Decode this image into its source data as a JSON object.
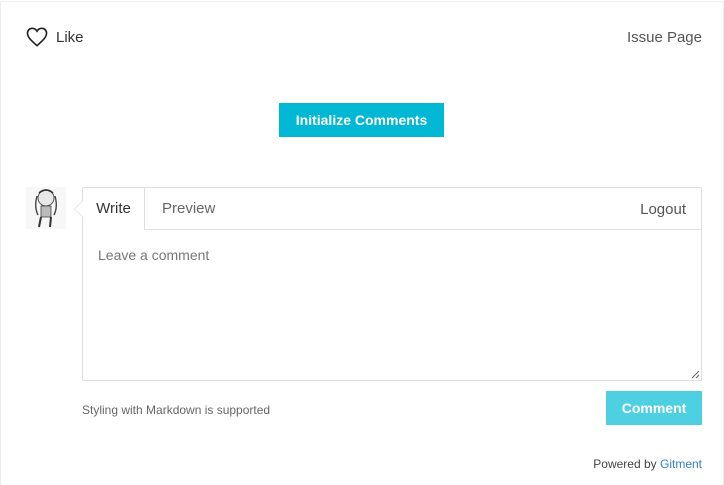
{
  "header": {
    "like_icon": "heart-outline-icon",
    "like_label": "Like",
    "issue_link": "Issue Page"
  },
  "init_button": "Initialize Comments",
  "editor": {
    "tabs": [
      {
        "label": "Write",
        "active": true
      },
      {
        "label": "Preview",
        "active": false
      }
    ],
    "logout": "Logout",
    "placeholder": "Leave a comment",
    "value": ""
  },
  "footer": {
    "markdown_note": "Styling with Markdown is supported",
    "comment_button": "Comment",
    "powered_by": "Powered by",
    "powered_link": "Gitment"
  },
  "colors": {
    "init_button": "#00b8d4",
    "comment_button": "#4dd0e1",
    "link": "#2f7fd1"
  }
}
